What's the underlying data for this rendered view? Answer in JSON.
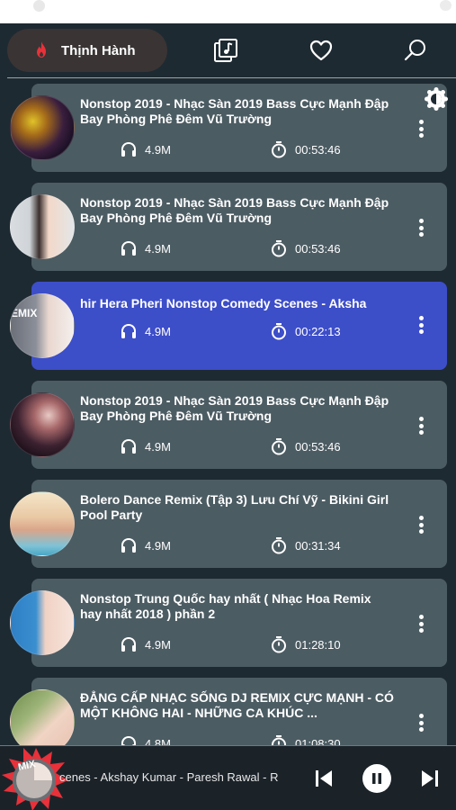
{
  "nav": {
    "home_label": "Thịnh Hành",
    "icons": [
      "flame-icon",
      "playlist-icon",
      "heart-icon",
      "search-icon"
    ]
  },
  "songs": [
    {
      "title": "Nonstop 2019 - Nhạc Sàn 2019 Bass Cực Mạnh Đập Bay Phòng Phê Đêm Vũ Trường",
      "listens": "4.9M",
      "duration": "00:53:46"
    },
    {
      "title": "Nonstop 2019 - Nhạc Sàn 2019 Bass Cực Mạnh Đập Bay Phòng Phê Đêm Vũ Trường",
      "listens": "4.9M",
      "duration": "00:53:46"
    },
    {
      "title": "hir Hera Pheri Nonstop Comedy Scenes - Aksha",
      "listens": "4.9M",
      "duration": "00:22:13",
      "thumb_text": "EMIX"
    },
    {
      "title": "Nonstop 2019 - Nhạc Sàn 2019 Bass Cực Mạnh Đập Bay Phòng Phê Đêm Vũ Trường",
      "listens": "4.9M",
      "duration": "00:53:46"
    },
    {
      "title": "Bolero Dance Remix (Tập 3) Lưu Chí Vỹ - Bikini Girl Pool Party",
      "listens": "4.9M",
      "duration": "00:31:34"
    },
    {
      "title": "Nonstop Trung Quốc hay nhất ( Nhạc Hoa Remix hay nhất 2018 ) phần 2",
      "listens": "4.9M",
      "duration": "01:28:10"
    },
    {
      "title": "ĐẲNG CẤP NHẠC SỐNG DJ REMIX CỰC MẠNH - CÓ MỘT KHÔNG HAI - NHỮNG CA KHÚC ...",
      "listens": "4.8M",
      "duration": "01:08:30"
    }
  ],
  "player": {
    "now_playing": "cenes - Akshay Kumar - Paresh Rawal - R",
    "disc_text": "MIX",
    "state": "playing"
  },
  "colors": {
    "background": "#1e2a32",
    "card": "#4c5c63",
    "card_active": "#3d4ec9",
    "accent": "#e8313a"
  }
}
